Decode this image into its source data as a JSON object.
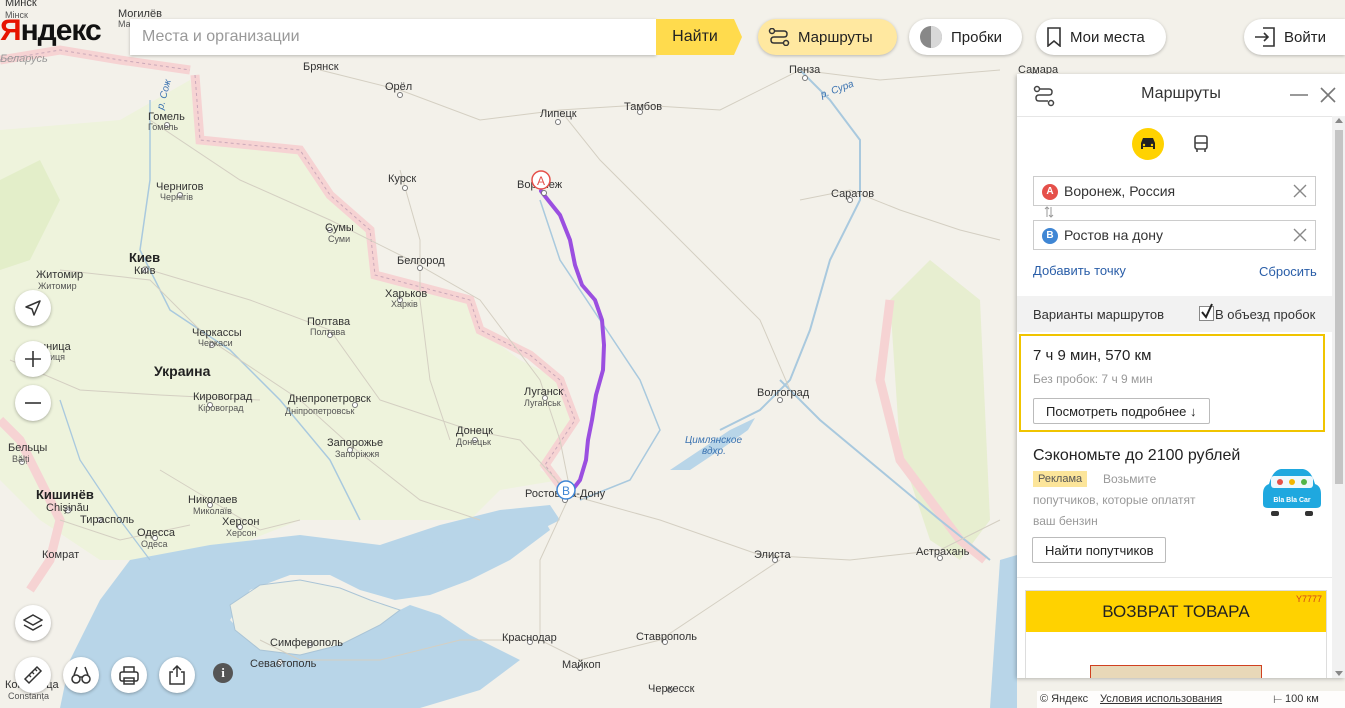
{
  "logo": {
    "part1": "Я",
    "part2": "ндекс"
  },
  "search": {
    "placeholder": "Места и организации",
    "button": "Найти"
  },
  "top_buttons": {
    "routes": "Маршруты",
    "traffic": "Пробки",
    "my_places": "Мои места",
    "login": "Войти"
  },
  "map_labels": [
    {
      "text": "Минск"
    },
    {
      "text": "Могилёв"
    },
    {
      "text": "Магілёў"
    },
    {
      "text": "Брянск"
    },
    {
      "text": "Орёл"
    },
    {
      "text": "Липецк"
    },
    {
      "text": "Тамбов"
    },
    {
      "text": "Пенза"
    },
    {
      "text": "Самара"
    },
    {
      "text": "Гомель"
    },
    {
      "text": "Гомель"
    },
    {
      "text": "Чернигов"
    },
    {
      "text": "Чернігів"
    },
    {
      "text": "Курск"
    },
    {
      "text": "Воронеж"
    },
    {
      "text": "Саратов"
    },
    {
      "text": "Сумы"
    },
    {
      "text": "Суми"
    },
    {
      "text": "Киев"
    },
    {
      "text": "Київ"
    },
    {
      "text": "Житомир"
    },
    {
      "text": "Житомир"
    },
    {
      "text": "Белгород"
    },
    {
      "text": "Харьков"
    },
    {
      "text": "Харків"
    },
    {
      "text": "Полтава"
    },
    {
      "text": "Полтава"
    },
    {
      "text": "Черкассы"
    },
    {
      "text": "Черкаси"
    },
    {
      "text": "Украина"
    },
    {
      "text": "Кировоград"
    },
    {
      "text": "Кіровоград"
    },
    {
      "text": "Днепропетровск"
    },
    {
      "text": "Дніпропетровськ"
    },
    {
      "text": "Луганск"
    },
    {
      "text": "Луганськ"
    },
    {
      "text": "Волгоград"
    },
    {
      "text": "Донецк"
    },
    {
      "text": "Донецьк"
    },
    {
      "text": "Запорожье"
    },
    {
      "text": "Запоріжжя"
    },
    {
      "text": "Цимлянское"
    },
    {
      "text": "вдхр."
    },
    {
      "text": "Бельцы"
    },
    {
      "text": "Bălți"
    },
    {
      "text": "Кишинёв"
    },
    {
      "text": "Chişinău"
    },
    {
      "text": "Николаев"
    },
    {
      "text": "Миколаїв"
    },
    {
      "text": "Тирасполь"
    },
    {
      "text": "Херсон"
    },
    {
      "text": "Херсон"
    },
    {
      "text": "Одесса"
    },
    {
      "text": "Одеса"
    },
    {
      "text": "Ростов-на-Дону"
    },
    {
      "text": "Комрат"
    },
    {
      "text": "Элиста"
    },
    {
      "text": "Астрахань"
    },
    {
      "text": "Симферополь"
    },
    {
      "text": "Краснодар"
    },
    {
      "text": "Ставрополь"
    },
    {
      "text": "Севастополь"
    },
    {
      "text": "Майкоп"
    },
    {
      "text": "Черкесск"
    },
    {
      "text": "Констанца"
    },
    {
      "text": "Constanța"
    },
    {
      "text": "р. Сож"
    },
    {
      "text": "р. Сура"
    },
    {
      "text": "Беларусь"
    },
    {
      "text": "Мінск"
    },
    {
      "text": "нница"
    },
    {
      "text": "ниця"
    }
  ],
  "route_markers": {
    "start": "A",
    "end": "B"
  },
  "panel": {
    "title": "Маршруты",
    "from_label": "A",
    "from_value": "Воронеж, Россия",
    "to_label": "B",
    "to_value": "Ростов на дону",
    "add_point": "Добавить точку",
    "reset": "Сбросить",
    "variants_label": "Варианты маршрутов",
    "avoid_traffic": "В объезд пробок",
    "avoid_traffic_checked": true,
    "route_summary": "7 ч 9 мин, 570 км",
    "no_traffic": "Без пробок: 7 ч 9 мин",
    "details_button": "Посмотреть подробнее ↓",
    "promo_title": "Сэкономьте до 2100 рублей",
    "ad_badge": "Реклама",
    "promo_text_1": "Возьмите",
    "promo_text_2": "попутчиков, которые оплатят",
    "promo_text_3": "ваш бензин",
    "promo_logo": "Bla Bla Car",
    "find_companions": "Найти попутчиков",
    "banner_title": "ВОЗВРАТ ТОВАРА",
    "banner_code": "Y7777"
  },
  "footer": {
    "copyright": "© Яндекс",
    "terms": "Условия использования",
    "scale": "100 км"
  },
  "colors": {
    "route": "#9b4fe0",
    "accent": "#ffdb4d",
    "border_region": "#f6d3d3",
    "sea": "#b8d5e8",
    "land_green": "#e3eec9"
  }
}
